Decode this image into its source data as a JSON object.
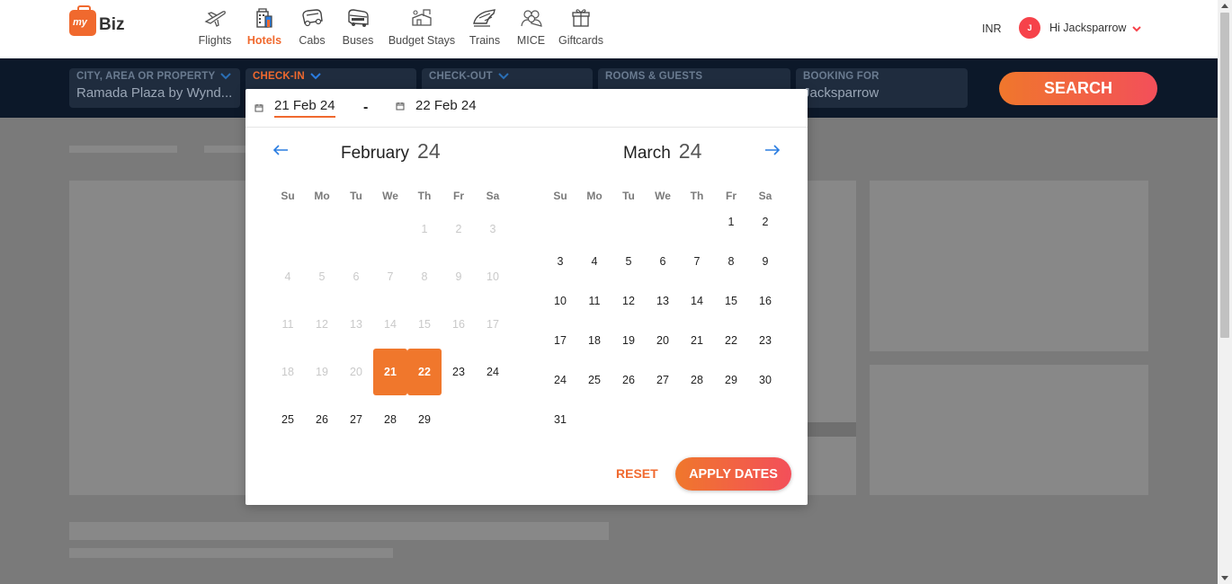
{
  "brand": {
    "logo_mark": "my",
    "logo_text": "Biz"
  },
  "nav": {
    "items": [
      {
        "label": "Flights",
        "icon": "airplane-icon",
        "active": false
      },
      {
        "label": "Hotels",
        "icon": "hotel-icon",
        "active": true
      },
      {
        "label": "Cabs",
        "icon": "cab-icon",
        "active": false
      },
      {
        "label": "Buses",
        "icon": "bus-icon",
        "active": false
      },
      {
        "label": "Budget Stays",
        "icon": "budget-stays-icon",
        "active": false
      },
      {
        "label": "Trains",
        "icon": "train-icon",
        "active": false
      },
      {
        "label": "MICE",
        "icon": "mice-icon",
        "active": false
      },
      {
        "label": "Giftcards",
        "icon": "giftcard-icon",
        "active": false
      }
    ],
    "currency": "INR",
    "user_initial": "J",
    "user_greeting": "Hi Jacksparrow"
  },
  "search": {
    "city_label": "CITY, AREA OR PROPERTY",
    "city_value": "Ramada Plaza by Wynd...",
    "checkin_label": "CHECK-IN",
    "checkout_label": "CHECK-OUT",
    "rooms_label": "ROOMS & GUESTS",
    "booking_label": "BOOKING FOR",
    "booking_value": "Jacksparrow",
    "search_button": "SEARCH"
  },
  "calendar": {
    "checkin_date": "21 Feb 24",
    "separator": "-",
    "checkout_date": "22 Feb 24",
    "weekdays": [
      "Su",
      "Mo",
      "Tu",
      "We",
      "Th",
      "Fr",
      "Sa"
    ],
    "months": [
      {
        "name": "February",
        "year": "24",
        "first_weekday": 4,
        "days": 29,
        "disabled_before": 21,
        "selected": [
          21,
          22
        ]
      },
      {
        "name": "March",
        "year": "24",
        "first_weekday": 5,
        "days": 31,
        "disabled_before": 0,
        "selected": []
      }
    ],
    "reset_label": "RESET",
    "apply_label": "APPLY DATES"
  },
  "colors": {
    "accent": "#f0692e",
    "selected_day": "#f0772c",
    "disabled_day": "#c9c9c9",
    "nav_arrow": "#2a7de1",
    "searchbar_bg": "#0c1829"
  }
}
